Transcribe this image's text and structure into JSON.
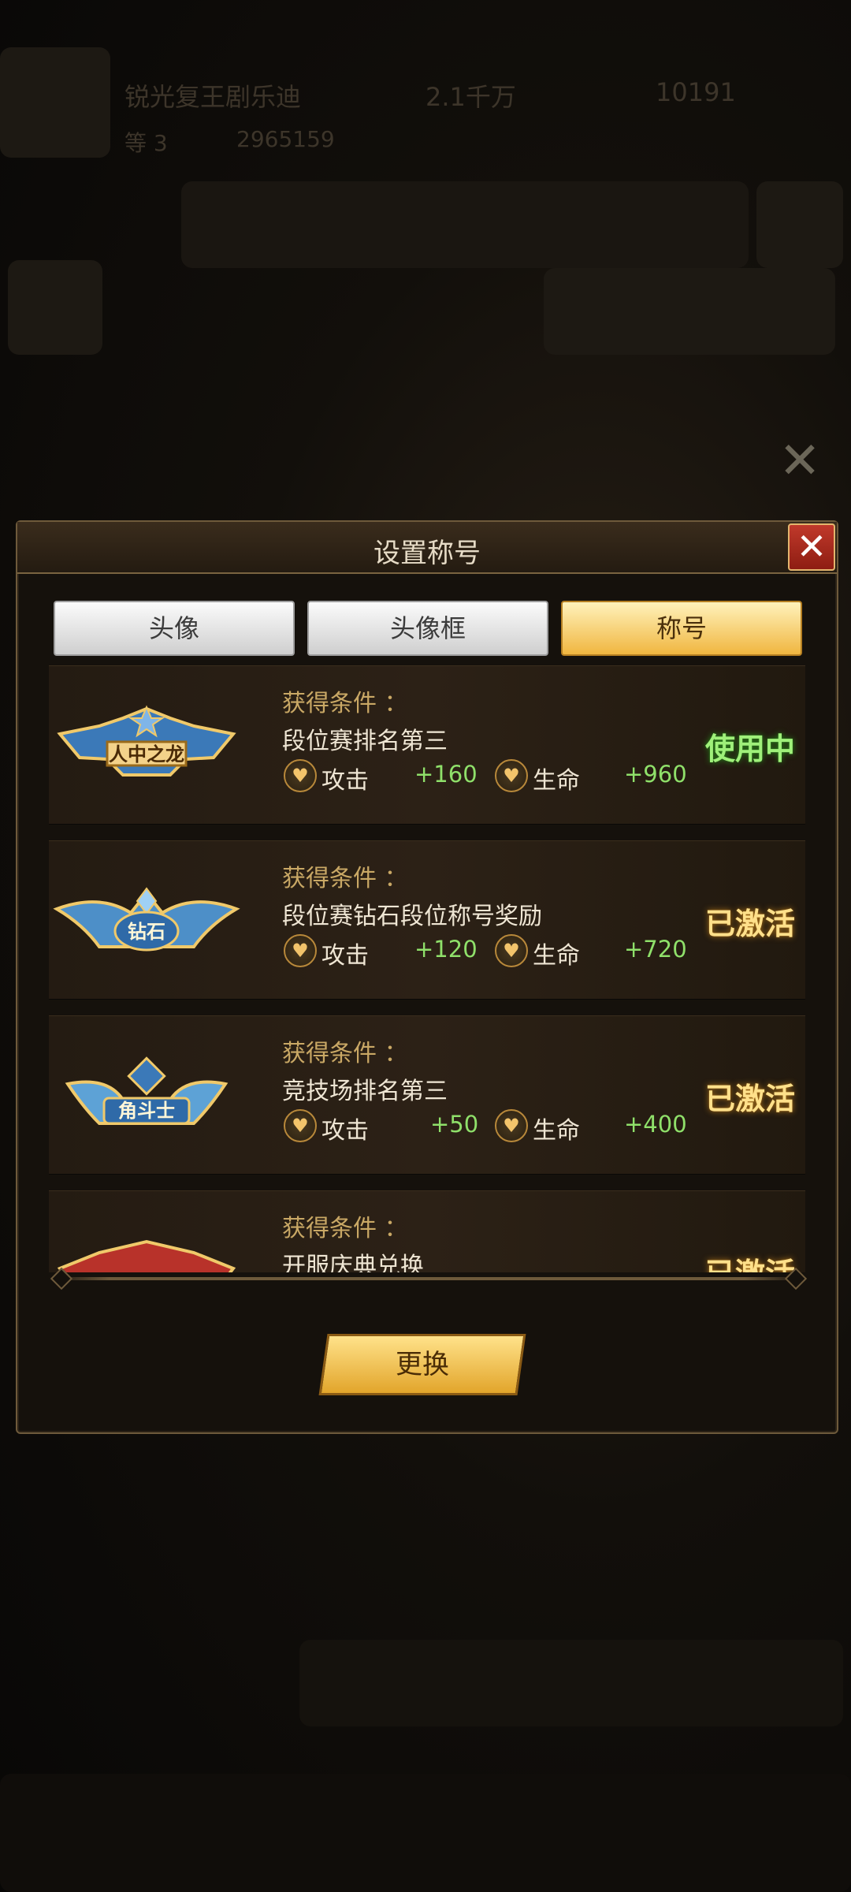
{
  "background": {
    "player_name": "锐光复王剧乐迪",
    "currency": "2.1千万",
    "gems": "10191",
    "level_text": "等 3",
    "power": "2965159"
  },
  "dialog": {
    "title": "设置称号",
    "tabs": [
      {
        "label": "头像",
        "active": false
      },
      {
        "label": "头像框",
        "active": false
      },
      {
        "label": "称号",
        "active": true
      }
    ],
    "condition_label": "获得条件 ：",
    "items": [
      {
        "badge_text": "人中之龙",
        "condition": "段位赛排名第三",
        "stats": [
          {
            "name": "攻击",
            "value": "+160"
          },
          {
            "name": "生命",
            "value": "+960"
          }
        ],
        "status": "使用中",
        "status_type": "inuse"
      },
      {
        "badge_text": "钻石",
        "condition": "段位赛钻石段位称号奖励",
        "stats": [
          {
            "name": "攻击",
            "value": "+120"
          },
          {
            "name": "生命",
            "value": "+720"
          }
        ],
        "status": "已激活",
        "status_type": "active"
      },
      {
        "badge_text": "角斗士",
        "condition": "竞技场排名第三",
        "stats": [
          {
            "name": "攻击",
            "value": "+50"
          },
          {
            "name": "生命",
            "value": "+400"
          }
        ],
        "status": "已激活",
        "status_type": "active"
      },
      {
        "badge_text": "",
        "condition": "开服庆典兑换",
        "stats": [],
        "status": "已激活",
        "status_type": "active"
      }
    ],
    "change_button": "更换"
  }
}
